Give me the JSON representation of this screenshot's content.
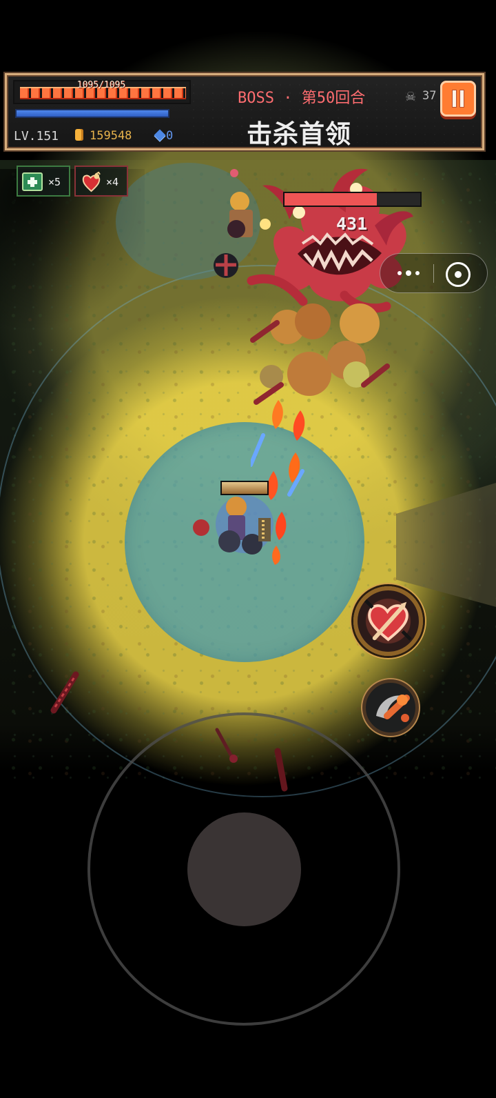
{
  "hud": {
    "health_text": "1095/1095",
    "mana_percent": 100,
    "level_text": "LV.151",
    "gold": "159548",
    "diamonds": "0",
    "boss_round": "BOSS · 第50回合",
    "objective": "击杀首领",
    "kill_count": "37",
    "icons": {
      "skull": "skull-icon",
      "pause": "pause-icon",
      "gold": "coin-icon",
      "diamond": "diamond-icon"
    }
  },
  "items": [
    {
      "name": "medical-kit-icon",
      "quantity": "×5"
    },
    {
      "name": "heart-potion-icon",
      "quantity": "×4"
    }
  ],
  "boss": {
    "health_percent": 68,
    "damage": "431",
    "color": "#c93b47"
  },
  "player": {
    "health_percent": 100
  },
  "controls": {
    "skill_1": "heart-skill-icon",
    "skill_2": "scythe-skill-icon",
    "joystick": "virtual-joystick"
  },
  "miniapp": {
    "more": "more-icon",
    "target": "target-icon"
  }
}
